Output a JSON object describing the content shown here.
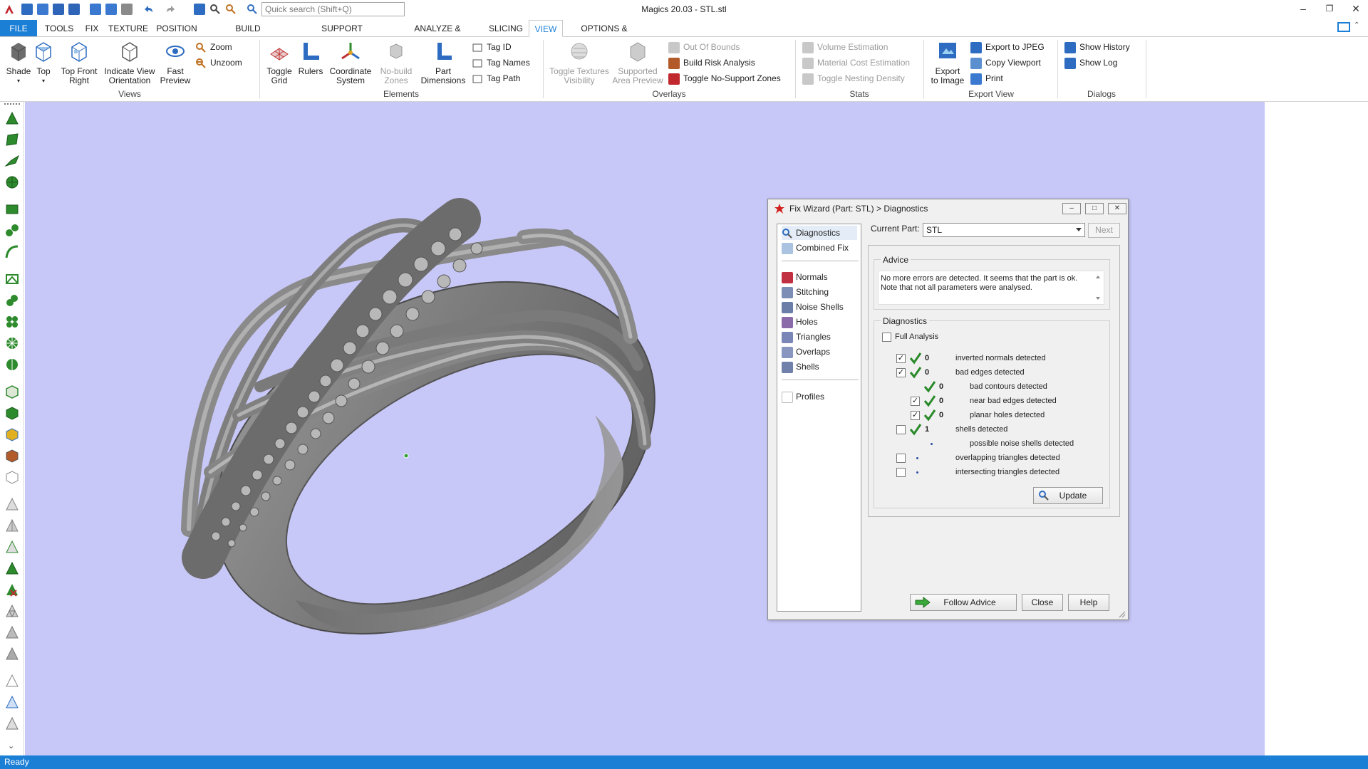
{
  "window": {
    "title": "Magics 20.03 - STL.stl",
    "search_placeholder": "Quick search (Shift+Q)"
  },
  "tabs": [
    "FILE",
    "TOOLS",
    "FIX",
    "TEXTURE",
    "POSITION",
    "BUILD PREPARATION",
    "SUPPORT GENERATION",
    "ANALYZE & REPORT",
    "SLICING",
    "VIEW",
    "OPTIONS & HELP"
  ],
  "active_tab": "VIEW",
  "ribbon": {
    "views": {
      "label": "Views",
      "shade": "Shade",
      "top": "Top",
      "top_front_right_1": "Top Front",
      "top_front_right_2": "Right",
      "indicate_1": "Indicate View",
      "indicate_2": "Orientation",
      "fast_1": "Fast",
      "fast_2": "Preview",
      "zoom": "Zoom",
      "unzoom": "Unzoom"
    },
    "elements": {
      "label": "Elements",
      "toggle_grid_1": "Toggle",
      "toggle_grid_2": "Grid",
      "rulers": "Rulers",
      "coord_1": "Coordinate",
      "coord_2": "System",
      "nobuild_1": "No-build",
      "nobuild_2": "Zones",
      "partdim_1": "Part",
      "partdim_2": "Dimensions",
      "tag_id": "Tag ID",
      "tag_names": "Tag Names",
      "tag_path": "Tag Path"
    },
    "overlays": {
      "label": "Overlays",
      "toggle_tex_1": "Toggle Textures",
      "toggle_tex_2": "Visibility",
      "supported_1": "Supported",
      "supported_2": "Area Preview",
      "out_of_bounds": "Out Of Bounds",
      "build_risk": "Build Risk Analysis",
      "toggle_nosupport": "Toggle No-Support Zones"
    },
    "stats": {
      "label": "Stats",
      "volume": "Volume Estimation",
      "material": "Material Cost Estimation",
      "nesting": "Toggle Nesting Density"
    },
    "export_view": {
      "label": "Export View",
      "export_img_1": "Export",
      "export_img_2": "to Image",
      "export_jpeg": "Export to JPEG",
      "copy_viewport": "Copy Viewport",
      "print": "Print"
    },
    "dialogs": {
      "label": "Dialogs",
      "show_history": "Show History",
      "show_log": "Show Log"
    }
  },
  "status": "Ready",
  "dialog": {
    "title": "Fix Wizard (Part: STL) > Diagnostics",
    "nav": [
      "Diagnostics",
      "Combined Fix",
      "Normals",
      "Stitching",
      "Noise Shells",
      "Holes",
      "Triangles",
      "Overlaps",
      "Shells",
      "Profiles"
    ],
    "current_part_label": "Current Part:",
    "current_part_value": "STL",
    "next": "Next",
    "advice_label": "Advice",
    "advice_text": "No more errors are detected. It seems that the part is ok. Note that not all parameters were analysed.",
    "diagnostics_label": "Diagnostics",
    "full_analysis": "Full Analysis",
    "rows": [
      {
        "count": "0",
        "text": "inverted normals detected"
      },
      {
        "count": "0",
        "text": "bad edges detected"
      },
      {
        "count": "0",
        "text": "bad contours detected"
      },
      {
        "count": "0",
        "text": "near bad edges detected"
      },
      {
        "count": "0",
        "text": "planar holes detected"
      },
      {
        "count": "1",
        "text": "shells detected"
      },
      {
        "count": "",
        "text": "possible noise shells detected"
      },
      {
        "count": "",
        "text": "overlapping triangles detected"
      },
      {
        "count": "",
        "text": "intersecting triangles detected"
      }
    ],
    "update": "Update",
    "follow_advice": "Follow Advice",
    "close": "Close",
    "help": "Help"
  },
  "colors": {
    "accent": "#1c7fd6",
    "viewport_bg": "#c8c8f8",
    "check_green": "#2a8a2a"
  }
}
